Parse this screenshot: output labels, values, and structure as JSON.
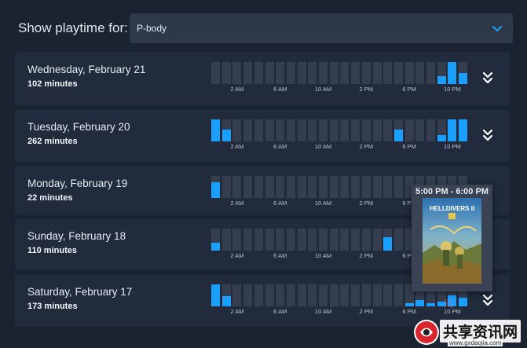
{
  "header": {
    "show_label": "Show playtime for:",
    "selected_game": "P-body"
  },
  "tick_labels": [
    "2 AM",
    "6 AM",
    "10 AM",
    "2 PM",
    "6 PM",
    "10 PM"
  ],
  "days": [
    {
      "title": "Wednesday, February 21",
      "minutes": "102 minutes",
      "hours": [
        0,
        0,
        0,
        0,
        0,
        0,
        0,
        0,
        0,
        0,
        0,
        0,
        0,
        0,
        0,
        0,
        0,
        0,
        0,
        0,
        0,
        0.35,
        1.0,
        0.5
      ]
    },
    {
      "title": "Tuesday, February 20",
      "minutes": "262 minutes",
      "hours": [
        1.0,
        0.55,
        0,
        0,
        0,
        0,
        0,
        0,
        0,
        0,
        0,
        0,
        0,
        0,
        0,
        0,
        0,
        0.55,
        0,
        0,
        0,
        0.3,
        1.0,
        1.0
      ]
    },
    {
      "title": "Monday, February 19",
      "minutes": "22 minutes",
      "hours": [
        0.7,
        0,
        0,
        0,
        0,
        0,
        0,
        0,
        0,
        0,
        0,
        0,
        0,
        0,
        0,
        0,
        0,
        0,
        0,
        0,
        0,
        0,
        0,
        0
      ]
    },
    {
      "title": "Sunday, February 18",
      "minutes": "110 minutes",
      "hours": [
        0.35,
        0,
        0,
        0,
        0,
        0,
        0,
        0,
        0,
        0,
        0,
        0,
        0,
        0,
        0,
        0,
        0.6,
        0,
        0,
        0,
        0,
        0,
        0,
        0
      ]
    },
    {
      "title": "Saturday, February 17",
      "minutes": "173 minutes",
      "hours": [
        1.0,
        0.45,
        0,
        0,
        0,
        0,
        0,
        0,
        0,
        0,
        0,
        0,
        0,
        0,
        0,
        0,
        0,
        0,
        0.15,
        0.3,
        0.15,
        0.2,
        0.5,
        0.4
      ]
    }
  ],
  "tooltip": {
    "title": "5:00 PM - 6:00 PM",
    "game_name": "HELLDIVERS II"
  },
  "watermark": {
    "text": "共享资讯网",
    "sub": "www.gxdaojia.com"
  },
  "colors": {
    "accent": "#1a9fff",
    "panel": "#222b3b",
    "background": "#1b2230",
    "empty_cell": "#353e4f"
  }
}
